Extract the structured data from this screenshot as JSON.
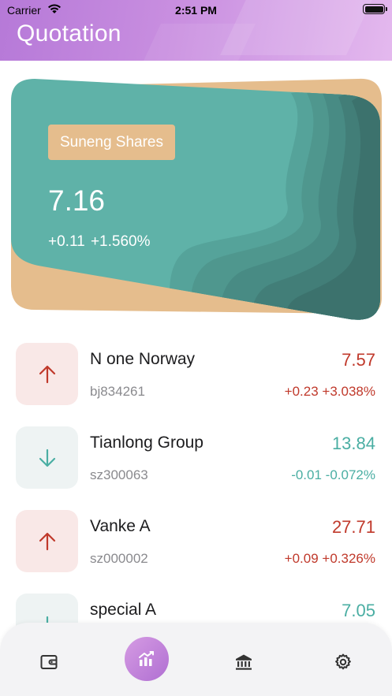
{
  "status_bar": {
    "carrier": "Carrier",
    "time": "2:51 PM"
  },
  "header": {
    "title": "Quotation"
  },
  "featured": {
    "name": "Suneng Shares",
    "price": "7.16",
    "change": "+0.11",
    "change_percent": "+1.560%"
  },
  "stocks": [
    {
      "name": "N one Norway",
      "code": "bj834261",
      "price": "7.57",
      "change": "+0.23",
      "change_percent": "+3.038%",
      "direction": "up"
    },
    {
      "name": "Tianlong Group",
      "code": "sz300063",
      "price": "13.84",
      "change": "-0.01",
      "change_percent": "-0.072%",
      "direction": "down"
    },
    {
      "name": "Vanke A",
      "code": "sz000002",
      "price": "27.71",
      "change": "+0.09",
      "change_percent": "+0.326%",
      "direction": "up"
    },
    {
      "name": "special A",
      "code": "",
      "price": "7.05",
      "change": "",
      "change_percent": "",
      "direction": "down"
    }
  ],
  "tabbar": {
    "items": [
      {
        "icon": "wallet-icon",
        "active": false
      },
      {
        "icon": "chart-icon",
        "active": true
      },
      {
        "icon": "bank-icon",
        "active": false
      },
      {
        "icon": "gear-icon",
        "active": false
      }
    ]
  },
  "colors": {
    "header_gradient_start": "#b679d8",
    "card_teal": "#5fb2a8",
    "card_gold": "#e5bd8d",
    "up_red": "#c0392b",
    "down_teal": "#4aaea3",
    "active_tab": "#b06fd2"
  }
}
